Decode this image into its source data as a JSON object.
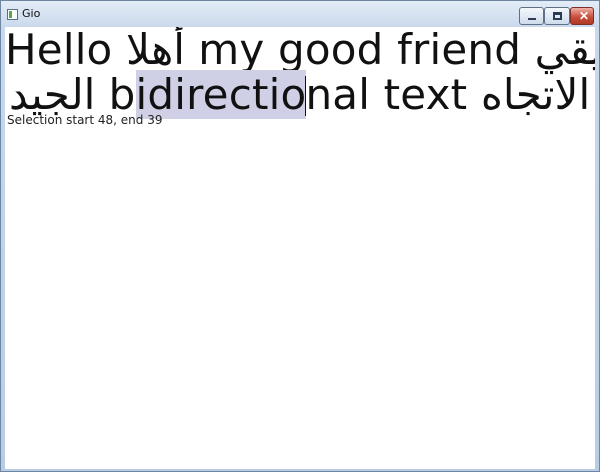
{
  "window": {
    "title": "Gio",
    "controls": {
      "minimize_icon": "minimize-icon",
      "maximize_icon": "maximize-icon",
      "close_icon": "close-icon",
      "close_label": "✕"
    }
  },
  "editor": {
    "line1": {
      "part1": "Hello",
      "part2": "أهلا",
      "part3": "my good friend",
      "part4": "صديقي"
    },
    "line2": {
      "part1": "الجيد",
      "part2_before": "b",
      "selected": "idirectio",
      "part2_after": "nal text",
      "part3": "نص ثنائي الاتجاه",
      "end": "."
    },
    "selection_color": "#cfd0e6"
  },
  "status": {
    "text": "Selection start 48, end 39"
  }
}
